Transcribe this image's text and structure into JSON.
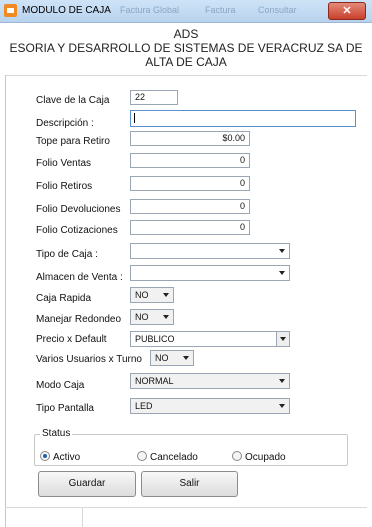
{
  "window": {
    "title": "MODULO DE CAJA",
    "bg_tabs": [
      "Factura Global",
      "Factura",
      "Consultar"
    ],
    "close_label": "✕"
  },
  "header": {
    "line1": "ADS",
    "line2": "ESORIA Y DESARROLLO DE SISTEMAS DE VERACRUZ SA DE",
    "line3": "ALTA DE CAJA"
  },
  "form": {
    "clave": {
      "label": "Clave de la Caja",
      "value": "22"
    },
    "descripcion": {
      "label": "Descripción :",
      "value": ""
    },
    "tope": {
      "label": "Tope para Retiro",
      "value": "$0.00"
    },
    "folio_ventas": {
      "label": "Folio Ventas",
      "value": "0"
    },
    "folio_retiros": {
      "label": "Folio Retiros",
      "value": "0"
    },
    "folio_devoluciones": {
      "label": "Folio Devoluciones",
      "value": "0"
    },
    "folio_cotizaciones": {
      "label": "Folio Cotizaciones",
      "value": "0"
    },
    "tipo_caja": {
      "label": "Tipo de Caja :",
      "value": ""
    },
    "almacen": {
      "label": "Almacen de Venta :",
      "value": ""
    },
    "caja_rapida": {
      "label": "Caja Rapida",
      "value": "NO"
    },
    "redondeo": {
      "label": "Manejar Redondeo",
      "value": "NO"
    },
    "precio": {
      "label": "Precio x Default",
      "value": "PUBLICO"
    },
    "varios_usuarios": {
      "label": "Varios Usuarios x Turno",
      "value": "NO"
    },
    "modo_caja": {
      "label": "Modo Caja",
      "value": "NORMAL"
    },
    "tipo_pantalla": {
      "label": "Tipo Pantalla",
      "value": "LED"
    }
  },
  "status": {
    "label": "Status",
    "options": [
      "Activo",
      "Cancelado",
      "Ocupado"
    ],
    "selected": "Activo"
  },
  "buttons": {
    "guardar": "Guardar",
    "salir": "Salir"
  },
  "colors": {
    "title_bar": "#b9d3ee",
    "close_button": "#c8402c",
    "app_icon": "#f08a24"
  }
}
